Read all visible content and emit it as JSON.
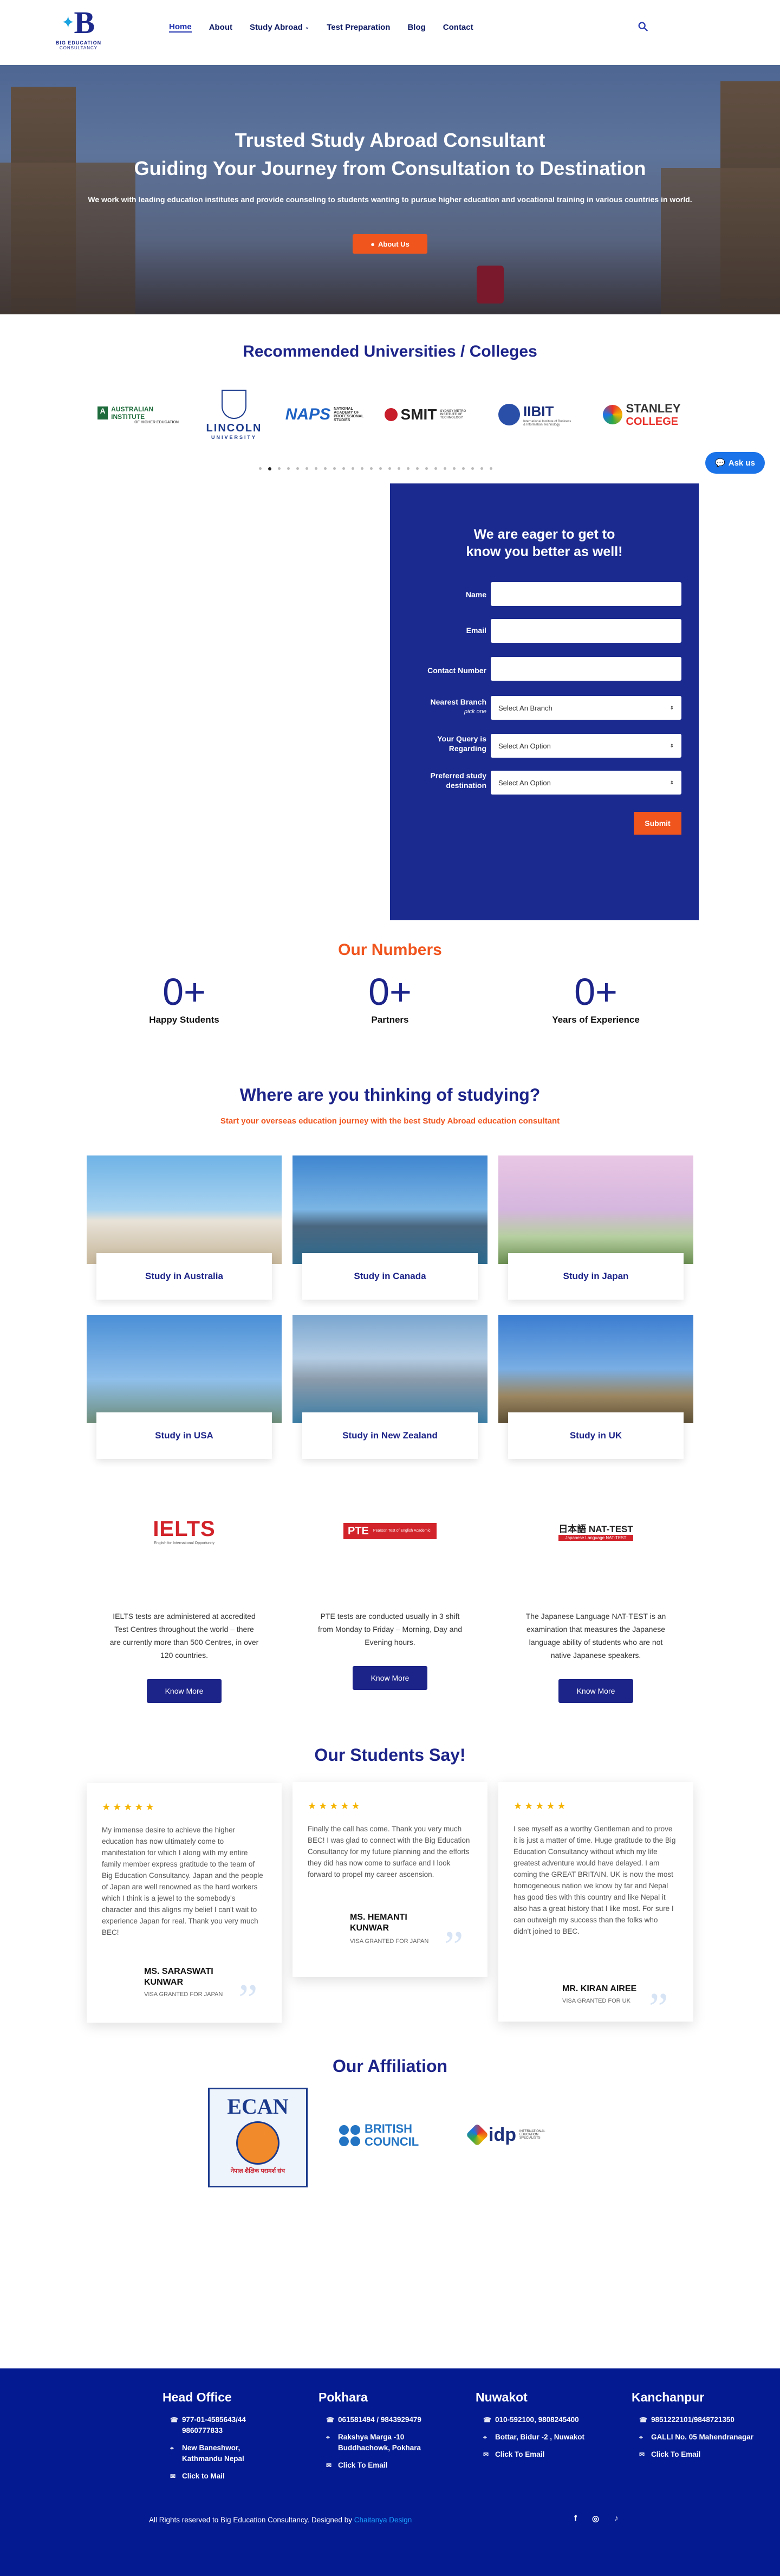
{
  "brand": {
    "logo_letter": "B",
    "logo_line1": "BIG EDUCATION",
    "logo_line2": "CONSULTANCY",
    "colors": {
      "navy": "#1d2489",
      "orange": "#f0551e",
      "footer": "#041a91"
    }
  },
  "nav": {
    "home": "Home",
    "about": "About",
    "study_abroad": "Study Abroad",
    "test_prep": "Test Preparation",
    "blog": "Blog",
    "contact": "Contact",
    "search_icon": "search-icon"
  },
  "hero": {
    "title1": "Trusted Study Abroad Consultant",
    "title2": "Guiding Your Journey from Consultation to Destination",
    "desc": "We work with leading education institutes and provide counseling to students wanting to pursue higher education and vocational training in various countries in world.",
    "button": "About Us"
  },
  "universities": {
    "title": "Recommended Universities / Colleges",
    "items": [
      {
        "name": "AUSTRALIAN INSTITUTE",
        "sub": "OF HIGHER EDUCATION"
      },
      {
        "name": "LINCOLN",
        "sub": "UNIVERSITY"
      },
      {
        "name": "NAPS",
        "sub": "NATIONAL ACADEMY OF PROFESSIONAL STUDIES"
      },
      {
        "name": "SMIT",
        "sub": "SYDNEY METRO INSTITUTE OF TECHNOLOGY"
      },
      {
        "name": "IIBIT",
        "sub": "International Institute of Business & Information Technology"
      },
      {
        "name": "STANLEY",
        "sub": "COLLEGE"
      }
    ]
  },
  "ask_us": "Ask us",
  "form": {
    "title_line1": "We are eager to get to",
    "title_line2": "know you better as well!",
    "name_label": "Name",
    "email_label": "Email",
    "contact_label": "Contact Number",
    "branch_label": "Nearest Branch",
    "branch_hint": "pick one",
    "branch_placeholder": "Select An Branch",
    "query_label1": "Your Query is",
    "query_label2": "Regarding",
    "query_placeholder": "Select An Option",
    "dest_label1": "Preferred study",
    "dest_label2": "destination",
    "dest_placeholder": "Select An Option",
    "submit": "Submit"
  },
  "numbers": {
    "title": "Our Numbers",
    "items": [
      {
        "value": "0+",
        "label": "Happy Students"
      },
      {
        "value": "0+",
        "label": "Partners"
      },
      {
        "value": "0+",
        "label": "Years of Experience"
      }
    ]
  },
  "destinations": {
    "title": "Where are you thinking of studying?",
    "subtitle": "Start your overseas education journey with the best Study Abroad education consultant",
    "items": [
      "Study in Australia",
      "Study in Canada",
      "Study in Japan",
      "Study in USA",
      "Study in New Zealand",
      "Study in UK"
    ]
  },
  "tests": {
    "items": [
      {
        "logo": "IELTS",
        "logo_sub": "English for International Opportunity",
        "text": "IELTS tests are administered at accredited Test Centres throughout the world – there are currently more than 500 Centres, in over 120 countries.",
        "button": "Know More"
      },
      {
        "logo": "PTE",
        "logo_sub": "Pearson Test of English Academic",
        "text": "PTE tests are conducted usually in 3 shift from Monday to Friday – Morning, Day and Evening hours.",
        "button": "Know More"
      },
      {
        "logo": "日本語 NAT-TEST",
        "logo_sub": "Japanese Language NAT-TEST",
        "text": "The Japanese Language NAT-TEST is an examination that measures the Japanese language ability of students who are not native Japanese speakers.",
        "button": "Know More"
      }
    ]
  },
  "testimonials": {
    "title": "Our Students Say!",
    "stars": "★★★★★",
    "items": [
      {
        "text": "My immense desire to achieve the higher education has now ultimately come to manifestation for which I along with my entire family member express gratitude to the team of Big Education Consultancy. Japan and the people of Japan are well renowned as the hard workers which I think is a jewel to the somebody's character and this aligns my belief I can't wait to experience Japan for real. Thank you very much BEC!",
        "name": "MS. SARASWATI KUNWAR",
        "visa": "VISA GRANTED FOR JAPAN"
      },
      {
        "text": "Finally the call has come. Thank you very much BEC! I was glad to connect with the Big Education Consultancy for my future planning and the efforts they did has now come to surface and I look forward to propel my career ascension.",
        "name": "MS. HEMANTI KUNWAR",
        "visa": "VISA GRANTED FOR JAPAN"
      },
      {
        "text": "I see myself as a worthy Gentleman and to prove it is just a matter of time. Huge gratitude to the Big Education Consultancy without which my life greatest adventure would have delayed. I am coming the GREAT BRITAIN. UK is now the most homogeneous nation we know by far and Nepal has good ties with this country and like Nepal it also has a great history that I like most. For sure I can outweigh my success than the folks who didn't joined to BEC.",
        "name": "MR. KIRAN AIREE",
        "visa": "VISA GRANTED FOR UK"
      }
    ]
  },
  "affiliation": {
    "title": "Our Affiliation",
    "items": [
      "ECAN",
      "BRITISH COUNCIL",
      "idp"
    ],
    "ecan_sub": "नेपाल शैक्षिक परामर्श संघ",
    "idp_sub": "INTERNATIONAL EDUCATION SPECIALISTS"
  },
  "footer": {
    "cols": [
      {
        "title": "Head Office",
        "phone": "977-01-4585643/44 9860777833",
        "address": "New Baneshwor, Kathmandu Nepal",
        "mail": "Click to Mail"
      },
      {
        "title": "Pokhara",
        "phone": "061581494 / 9843929479",
        "address": "Rakshya Marga -10 Buddhachowk, Pokhara",
        "mail": "Click To Email"
      },
      {
        "title": "Nuwakot",
        "phone": "010-592100, 9808245400",
        "address": "Bottar, Bidur -2 , Nuwakot",
        "mail": "Click To Email"
      },
      {
        "title": "Kanchanpur",
        "phone": "9851222101/9848721350",
        "address": "GALLI No. 05 Mahendranagar",
        "mail": "Click To Email"
      }
    ],
    "copyright": "All Rights reserved to Big Education Consultancy. Designed by",
    "designer": "Chaitanya Design",
    "social": [
      "f",
      "◎",
      "♪"
    ]
  }
}
